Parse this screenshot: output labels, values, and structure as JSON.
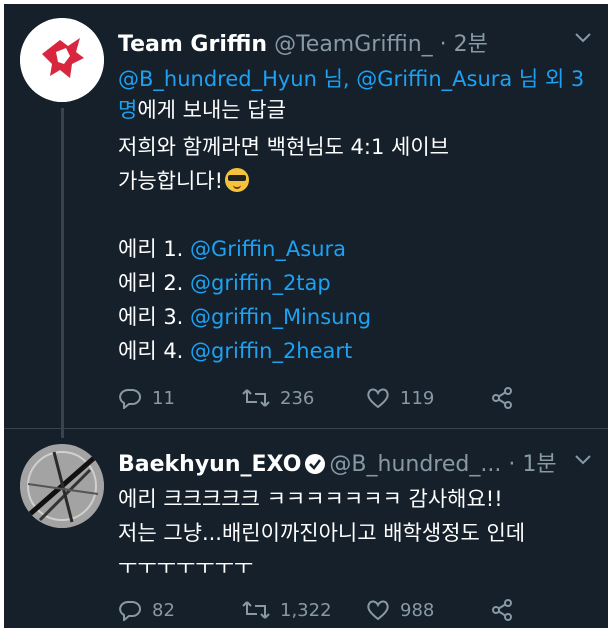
{
  "tweets": [
    {
      "display_name": "Team Griffin",
      "handle": "@TeamGriffin_",
      "time": "2분",
      "reply_to": {
        "mentions": [
          "@B_hundred_Hyun 님",
          "@Griffin_Asura 님"
        ],
        "others": "외 3명",
        "suffix": "에게 보내는 답글"
      },
      "body": {
        "line1": "저희와 함께라면 백현님도 4:1 세이브",
        "line2": "가능합니다!",
        "list": [
          {
            "prefix": "에리 1. ",
            "mention": "@Griffin_Asura"
          },
          {
            "prefix": "에리 2. ",
            "mention": "@griffin_2tap"
          },
          {
            "prefix": "에리 3. ",
            "mention": "@griffin_Minsung"
          },
          {
            "prefix": "에리 4. ",
            "mention": "@griffin_2heart"
          }
        ]
      },
      "stats": {
        "replies": "11",
        "retweets": "236",
        "likes": "119"
      }
    },
    {
      "display_name": "Baekhyun_EXO",
      "handle": "@B_hundred_...",
      "time": "1분",
      "body": {
        "line1": "에리 크크크크크 ㅋㅋㅋㅋㅋㅋㅋ 감사해요!!",
        "line2": "저는 그냥...배린이까진아니고 배학생정도 인데",
        "line3": "ㅜㅜㅜㅜㅜㅜㅜ"
      },
      "stats": {
        "replies": "82",
        "retweets": "1,322",
        "likes": "988"
      }
    }
  ],
  "icons": {
    "reply": "reply-icon",
    "retweet": "retweet-icon",
    "like": "like-icon",
    "share": "share-icon",
    "more": "chevron-down-icon",
    "verified": "verified-badge-icon"
  },
  "colors": {
    "background": "#15202b",
    "text": "#ffffff",
    "muted": "#8899a6",
    "link": "#1da1f2",
    "griffin_red": "#d7263d"
  }
}
